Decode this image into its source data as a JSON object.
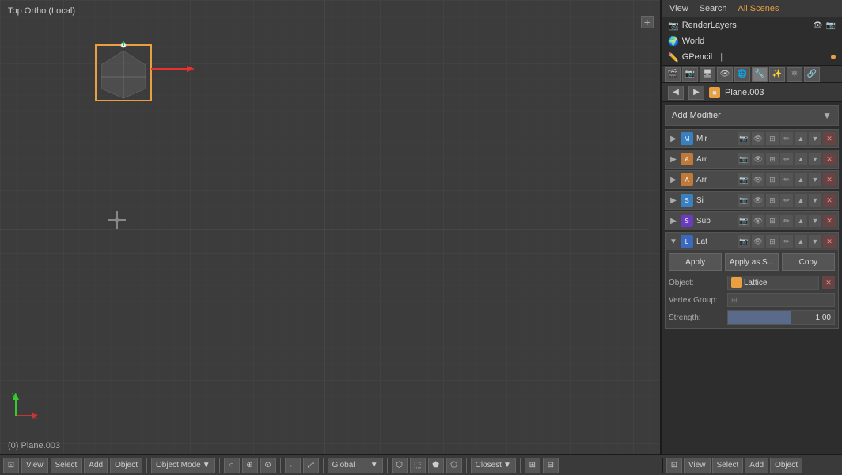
{
  "viewport": {
    "label": "Top Ortho (Local)",
    "status": "(0) Plane.003"
  },
  "outliner": {
    "tabs": [
      "View",
      "Search",
      "All Scenes"
    ],
    "active_tab": "All Scenes",
    "items": [
      {
        "icon": "📷",
        "label": "RenderLayers",
        "dot": true
      },
      {
        "icon": "🌍",
        "label": "World",
        "dot": false
      },
      {
        "icon": "✏️",
        "label": "GPencil",
        "dot": true,
        "extra": "•"
      }
    ]
  },
  "properties": {
    "object_name": "Plane.003",
    "add_modifier_label": "Add Modifier",
    "modifiers": [
      {
        "name": "Mir",
        "type": "mirror",
        "color": "blue",
        "collapsed": true
      },
      {
        "name": "Arr",
        "type": "array",
        "color": "orange",
        "collapsed": true
      },
      {
        "name": "Arr",
        "type": "array",
        "color": "orange",
        "collapsed": true
      },
      {
        "name": "Si",
        "type": "simple_deform",
        "color": "blue",
        "collapsed": true
      },
      {
        "name": "Sub",
        "type": "subsurf",
        "color": "blue",
        "collapsed": true
      },
      {
        "name": "Lat",
        "type": "lattice",
        "color": "blue",
        "collapsed": false
      }
    ],
    "lattice_modifier": {
      "apply_label": "Apply",
      "apply_as_label": "Apply as S...",
      "copy_label": "Copy",
      "object_label": "Object:",
      "object_value": "Lattice",
      "vertex_group_label": "Vertex Group:",
      "vertex_group_value": "",
      "strength_label": "Strength:",
      "strength_value": "1.00"
    }
  },
  "bottom_toolbar": {
    "viewport": {
      "view_label": "View",
      "select_label": "Select",
      "add_label": "Add",
      "object_label": "Object",
      "mode_label": "Object Mode",
      "global_label": "Global",
      "closest_label": "Closest"
    },
    "panel": {
      "view_label": "View",
      "select_label": "Select",
      "add_label": "Add",
      "object_label": "Object"
    }
  }
}
